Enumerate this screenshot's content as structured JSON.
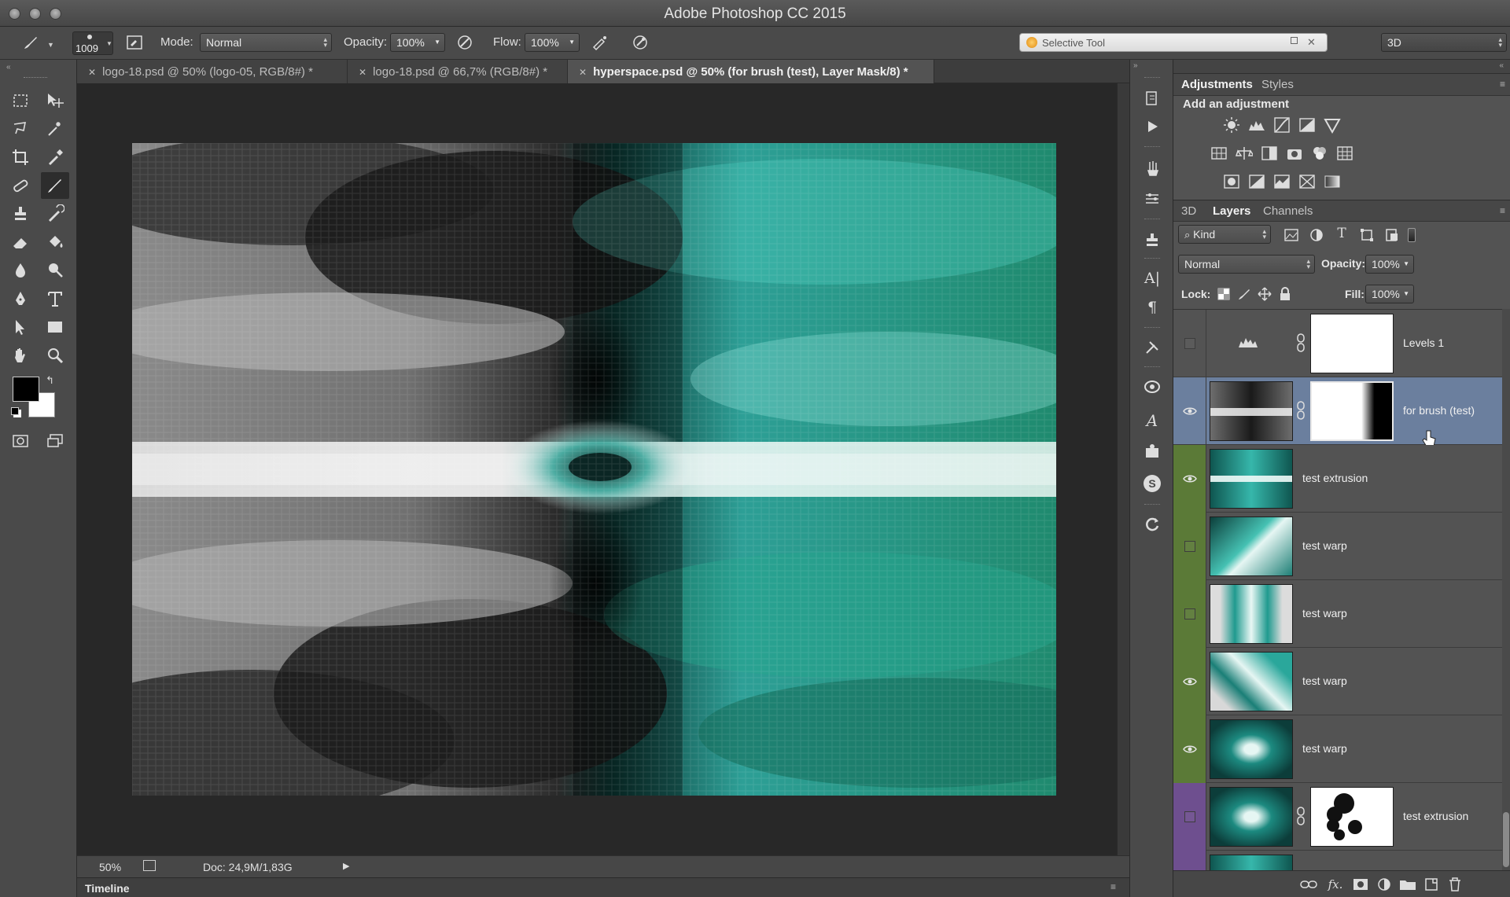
{
  "window": {
    "title": "Adobe Photoshop CC 2015"
  },
  "options_bar": {
    "brush_size": "1009",
    "mode_label": "Mode:",
    "mode_value": "Normal",
    "opacity_label": "Opacity:",
    "opacity_value": "100%",
    "flow_label": "Flow:",
    "flow_value": "100%",
    "search_text": "Selective Tool",
    "workspace_value": "3D"
  },
  "tabs": [
    {
      "label": "logo-18.psd @ 50% (logo-05, RGB/8#) *"
    },
    {
      "label": "logo-18.psd @ 66,7% (RGB/8#) *"
    },
    {
      "label": "hyperspace.psd @ 50% (for brush (test), Layer Mask/8) *"
    }
  ],
  "status": {
    "zoom": "50%",
    "doc": "Doc: 24,9M/1,83G"
  },
  "timeline": {
    "label": "Timeline"
  },
  "adjustments": {
    "tab_adjustments": "Adjustments",
    "tab_styles": "Styles",
    "heading": "Add an adjustment"
  },
  "layers_panel": {
    "tab_3d": "3D",
    "tab_layers": "Layers",
    "tab_channels": "Channels",
    "filter_value": "Kind",
    "blend_mode": "Normal",
    "opacity_label": "Opacity:",
    "opacity_value": "100%",
    "lock_label": "Lock:",
    "fill_label": "Fill:",
    "fill_value": "100%",
    "layers": [
      {
        "name": "Levels 1"
      },
      {
        "name": "for brush (test)"
      },
      {
        "name": "test extrusion"
      },
      {
        "name": "test warp"
      },
      {
        "name": "test warp"
      },
      {
        "name": "test warp"
      },
      {
        "name": "test warp"
      },
      {
        "name": "test extrusion"
      }
    ]
  },
  "colors": {
    "ui_dark": "#282828",
    "ui_panel": "#535353",
    "selected_layer": "#6b7f9e",
    "label_green": "#5b7a37",
    "label_purple": "#6e4f8f",
    "art_teal": "#2a9c94"
  }
}
